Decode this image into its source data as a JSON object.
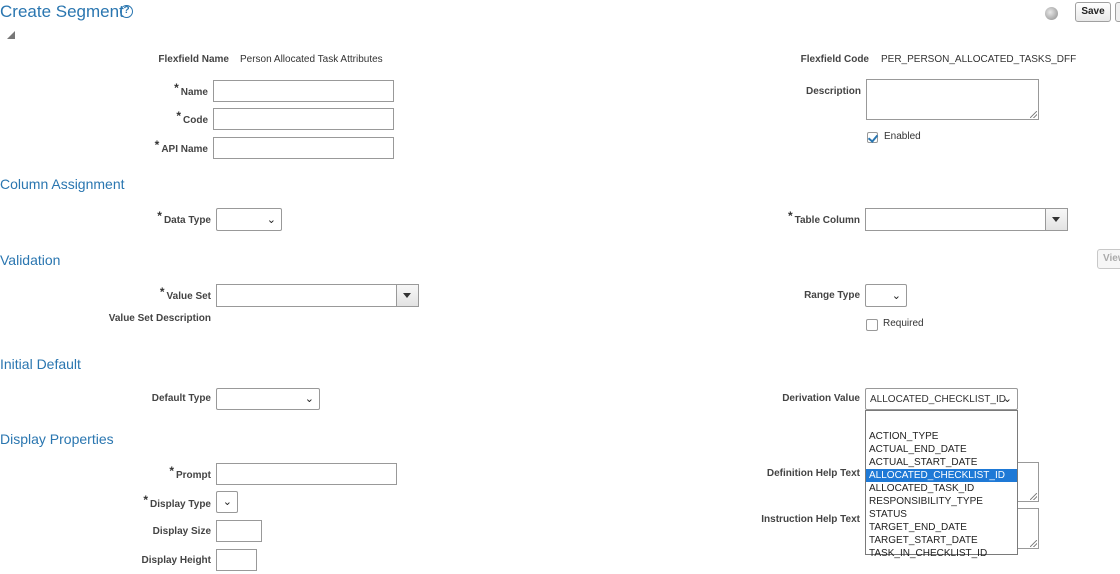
{
  "header": {
    "title": "Create Segment",
    "save_label": "Save"
  },
  "icons": {
    "help": "help-circle-icon",
    "collapse": "collapse-triangle-icon",
    "globe": "globe-icon",
    "checkmark": "check-icon"
  },
  "colors": {
    "accent": "#2a76b0",
    "selection": "#1e79d6"
  },
  "flexfield": {
    "name_label": "Flexfield Name",
    "name_value": "Person Allocated Task Attributes",
    "code_label": "Flexfield Code",
    "code_value": "PER_PERSON_ALLOCATED_TASKS_DFF"
  },
  "fields": {
    "name_label": "Name",
    "code_label": "Code",
    "api_name_label": "API Name",
    "description_label": "Description",
    "enabled_label": "Enabled"
  },
  "sections": {
    "column_assignment": "Column Assignment",
    "validation": "Validation",
    "initial_default": "Initial Default",
    "display_properties": "Display Properties"
  },
  "column_assignment": {
    "data_type_label": "Data Type",
    "table_column_label": "Table Column"
  },
  "validation": {
    "view_label": "View",
    "value_set_label": "Value Set",
    "value_set_description_label": "Value Set Description",
    "range_type_label": "Range Type",
    "required_label": "Required"
  },
  "initial_default": {
    "default_type_label": "Default Type",
    "derivation_value_label": "Derivation Value",
    "derivation_value_selected": "ALLOCATED_CHECKLIST_ID",
    "options": [
      "",
      "ACTION_TYPE",
      "ACTUAL_END_DATE",
      "ACTUAL_START_DATE",
      "ALLOCATED_CHECKLIST_ID",
      "ALLOCATED_TASK_ID",
      "RESPONSIBILITY_TYPE",
      "STATUS",
      "TARGET_END_DATE",
      "TARGET_START_DATE",
      "TASK_IN_CHECKLIST_ID"
    ]
  },
  "display": {
    "prompt_label": "Prompt",
    "display_type_label": "Display Type",
    "display_size_label": "Display Size",
    "display_height_label": "Display Height",
    "definition_help_label": "Definition Help Text",
    "instruction_help_label": "Instruction Help Text"
  }
}
